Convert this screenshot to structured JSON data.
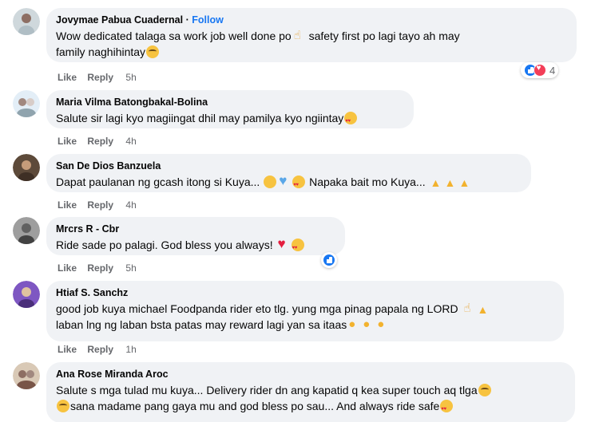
{
  "comments": [
    {
      "author": "Jovymae Pabua Cuadernal",
      "follow_label": "Follow",
      "follow_sep": "·",
      "line1": "Wow dedicated talaga sa work job well done po",
      "line1b": "safety first po lagi tayo ah may",
      "line2": "family naghihintay",
      "like": "Like",
      "reply": "Reply",
      "time": "5h",
      "reaction_count": "4"
    },
    {
      "author": "Maria Vilma Batongbakal-Bolina",
      "line1": "Salute sir lagi kyo magiingat dhil may pamilya kyo ngiintay",
      "like": "Like",
      "reply": "Reply",
      "time": "4h"
    },
    {
      "author": "San De Dios Banzuela",
      "line1": "Dapat paulanan ng gcash itong si Kuya...",
      "line1b": "Napaka bait mo Kuya...",
      "like": "Like",
      "reply": "Reply",
      "time": "4h"
    },
    {
      "author": "Mrcrs R - Cbr",
      "line1": "Ride sade po palagi. God bless you always!",
      "like": "Like",
      "reply": "Reply",
      "time": "5h"
    },
    {
      "author": "Htiaf S. Sanchz",
      "line1": "good job kuya michael Foodpanda rider eto tlg. yung mga pinag papala ng LORD",
      "line2": "laban lng ng laban bsta patas may reward lagi yan sa itaas",
      "like": "Like",
      "reply": "Reply",
      "time": "1h"
    },
    {
      "author": "Ana Rose Miranda Aroc",
      "line1": "Salute s mga tulad mu kuya... Delivery rider dn ang kapatid q kea super touch aq tlga",
      "line2": "sana madame pang gaya mu and god bless po sau... And always ride safe"
    }
  ],
  "colors": {
    "bubble": "#f0f2f5",
    "meta": "#65676b",
    "link": "#1877f2"
  }
}
